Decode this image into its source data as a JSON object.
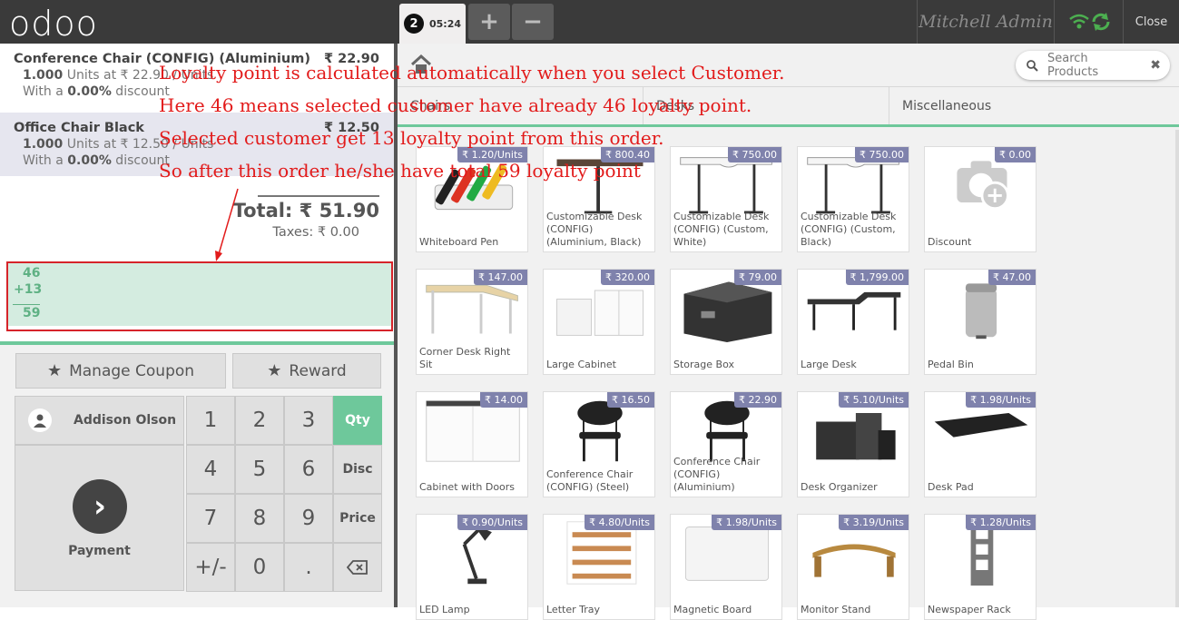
{
  "topbar": {
    "logo": "odoo",
    "order_number": "2",
    "order_time": "05:24",
    "add_order": "+",
    "remove_order": "−",
    "user": "Mitchell Admin",
    "close": "Close"
  },
  "order_lines": [
    {
      "name": "Conference Chair (CONFIG) (Aluminium)",
      "price": "₹ 22.90",
      "qty": "1.000",
      "unit_text": " Units at ₹ 22.90 / Units",
      "discount_pre": "With a ",
      "discount": "0.00%",
      "discount_post": " discount"
    },
    {
      "name": "Office Chair Black",
      "price": "₹ 12.50",
      "qty": "1.000",
      "unit_text": " Units at ₹ 12.50 / Units",
      "discount_pre": "With a ",
      "discount": "0.00%",
      "discount_post": " discount"
    }
  ],
  "summary": {
    "total": "Total: ₹ 51.90",
    "taxes": "Taxes: ₹ 0.00"
  },
  "loyalty": {
    "current": "46",
    "earned": "+13",
    "new_total": "59"
  },
  "controls": {
    "manage_coupon": "Manage Coupon",
    "reward": "Reward"
  },
  "customer": {
    "name": "Addison Olson"
  },
  "payment": {
    "label": "Payment"
  },
  "numpad": {
    "keys": [
      "1",
      "2",
      "3",
      "4",
      "5",
      "6",
      "7",
      "8",
      "9",
      "+/-",
      "0",
      "."
    ],
    "modes": [
      "Qty",
      "Disc",
      "Price"
    ]
  },
  "search": {
    "placeholder": "Search Products"
  },
  "categories": [
    "Chairs",
    "Desks",
    "Miscellaneous"
  ],
  "products": [
    {
      "name": "Whiteboard Pen",
      "price": "₹ 1.20/Units",
      "icon": "pens"
    },
    {
      "name": "Customizable Desk (CONFIG) (Aluminium, Black)",
      "price": "₹ 800.40",
      "icon": "desk-dark"
    },
    {
      "name": "Customizable Desk (CONFIG) (Custom, White)",
      "price": "₹ 750.00",
      "icon": "desk-white"
    },
    {
      "name": "Customizable Desk (CONFIG) (Custom, Black)",
      "price": "₹ 750.00",
      "icon": "desk-white"
    },
    {
      "name": "Discount",
      "price": "₹ 0.00",
      "icon": "camera"
    },
    {
      "name": "Corner Desk Right Sit",
      "price": "₹ 147.00",
      "icon": "corner-desk"
    },
    {
      "name": "Large Cabinet",
      "price": "₹ 320.00",
      "icon": "cabinet"
    },
    {
      "name": "Storage Box",
      "price": "₹ 79.00",
      "icon": "box"
    },
    {
      "name": "Large Desk",
      "price": "₹ 1,799.00",
      "icon": "large-desk"
    },
    {
      "name": "Pedal Bin",
      "price": "₹ 47.00",
      "icon": "bin"
    },
    {
      "name": "Cabinet with Doors",
      "price": "₹ 14.00",
      "icon": "cabinet-doors"
    },
    {
      "name": "Conference Chair (CONFIG) (Steel)",
      "price": "₹ 16.50",
      "icon": "chair"
    },
    {
      "name": "Conference Chair (CONFIG) (Aluminium)",
      "price": "₹ 22.90",
      "icon": "chair"
    },
    {
      "name": "Desk Organizer",
      "price": "₹ 5.10/Units",
      "icon": "organizer"
    },
    {
      "name": "Desk Pad",
      "price": "₹ 1.98/Units",
      "icon": "pad"
    },
    {
      "name": "LED Lamp",
      "price": "₹ 0.90/Units",
      "icon": "lamp"
    },
    {
      "name": "Letter Tray",
      "price": "₹ 4.80/Units",
      "icon": "tray"
    },
    {
      "name": "Magnetic Board",
      "price": "₹ 1.98/Units",
      "icon": "board"
    },
    {
      "name": "Monitor Stand",
      "price": "₹ 3.19/Units",
      "icon": "stand"
    },
    {
      "name": "Newspaper Rack",
      "price": "₹ 1.28/Units",
      "icon": "rack"
    }
  ],
  "annotation": {
    "line1": "Loyalty point is calculated automatically when you select Customer.",
    "line2": "Here 46 means selected customer have already 46 loyalty point.",
    "line3": "Selected customer get 13 loyalty point from this order.",
    "line4": "So after this order he/she have total 59 loyalty point",
    "color": "#e21b1b"
  }
}
